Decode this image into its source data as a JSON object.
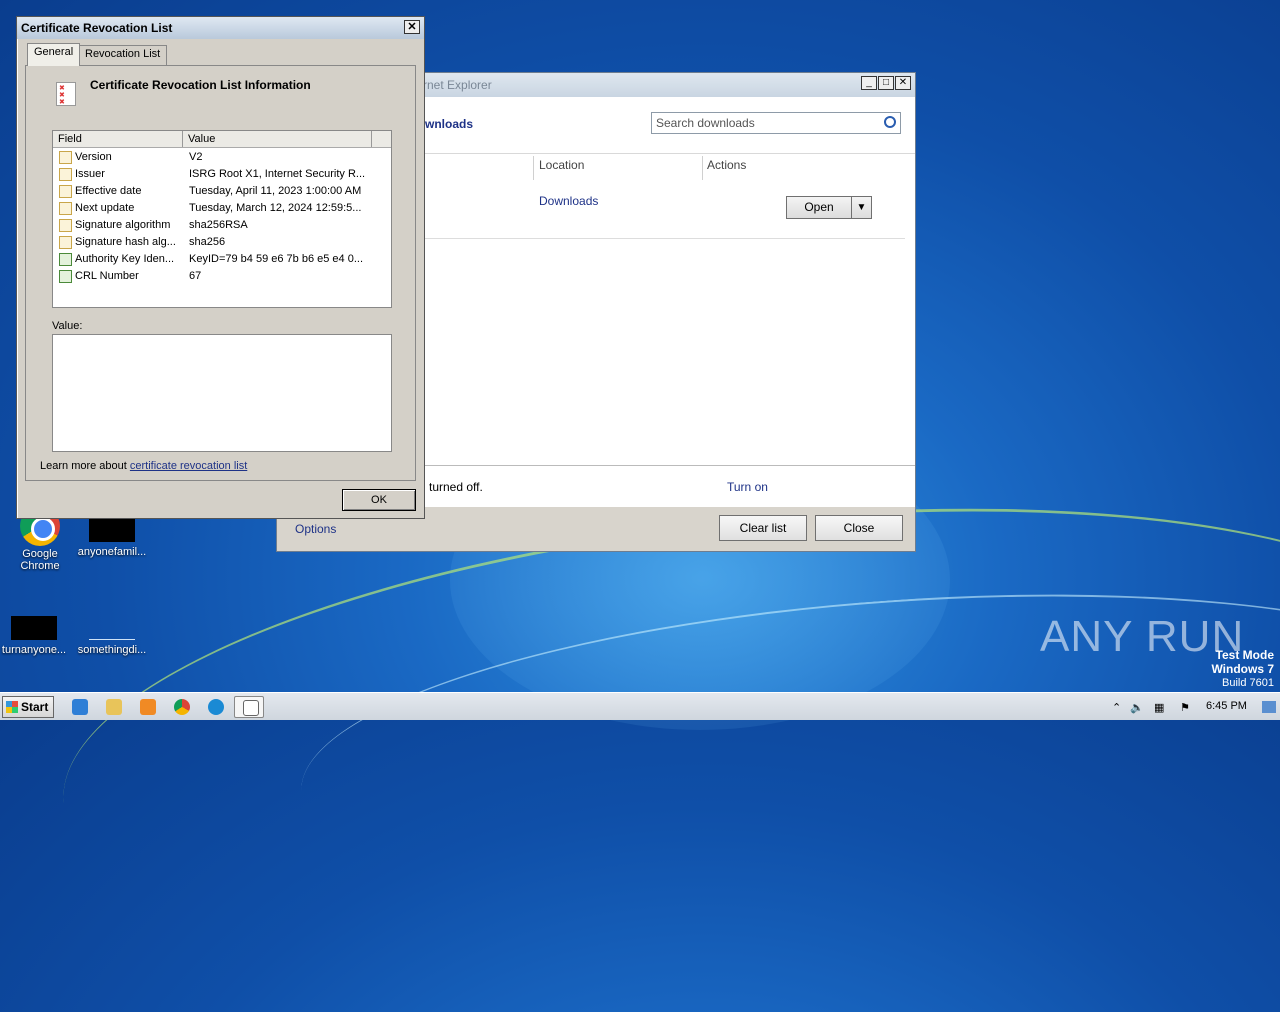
{
  "desktop": {
    "icons": [
      {
        "label": "Google Chrome"
      },
      {
        "label": "anyonefamil..."
      },
      {
        "label": "turnanyone..."
      },
      {
        "label": "somethingdi..."
      }
    ],
    "watermark": "ANY RUN",
    "test_mode": {
      "line1": "Test Mode",
      "line2": "Windows 7",
      "line3": "Build 7601"
    }
  },
  "ie_window": {
    "title": "rnet Explorer",
    "heading": "wnloads",
    "search": {
      "placeholder": "Search downloads"
    },
    "columns": [
      "Location",
      "Actions"
    ],
    "download": {
      "location": "Downloads",
      "open_label": "Open"
    },
    "notice": {
      "text": "turned off.",
      "link": "Turn on"
    },
    "footer": {
      "options": "Options",
      "clear_list": "Clear list",
      "close": "Close"
    }
  },
  "crl_dialog": {
    "title": "Certificate Revocation List",
    "tabs": [
      "General",
      "Revocation List"
    ],
    "info_title": "Certificate Revocation List Information",
    "table_headers": {
      "field": "Field",
      "value": "Value"
    },
    "rows": [
      {
        "field": "Version",
        "value": "V2",
        "icon": "doc-icon"
      },
      {
        "field": "Issuer",
        "value": "ISRG Root X1, Internet Security R...",
        "icon": "doc-icon"
      },
      {
        "field": "Effective date",
        "value": "Tuesday, April 11, 2023 1:00:00 AM",
        "icon": "doc-icon"
      },
      {
        "field": "Next update",
        "value": "Tuesday, March 12, 2024 12:59:5...",
        "icon": "doc-icon"
      },
      {
        "field": "Signature algorithm",
        "value": "sha256RSA",
        "icon": "doc-icon"
      },
      {
        "field": "Signature hash alg...",
        "value": "sha256",
        "icon": "doc-icon"
      },
      {
        "field": "Authority Key Iden...",
        "value": "KeyID=79 b4 59 e6 7b b6 e5 e4 0...",
        "icon": "extension-icon"
      },
      {
        "field": "CRL Number",
        "value": "67",
        "icon": "extension-icon"
      }
    ],
    "value_label": "Value:",
    "learn_more_prefix": "Learn more about ",
    "learn_more_link": "certificate revocation list",
    "ok_label": "OK"
  },
  "taskbar": {
    "start_label": "Start",
    "clock": "6:45 PM",
    "apps": [
      "internet-explorer-icon",
      "explorer-icon",
      "media-player-icon",
      "chrome-icon",
      "edge-icon",
      "certificate-icon"
    ]
  }
}
